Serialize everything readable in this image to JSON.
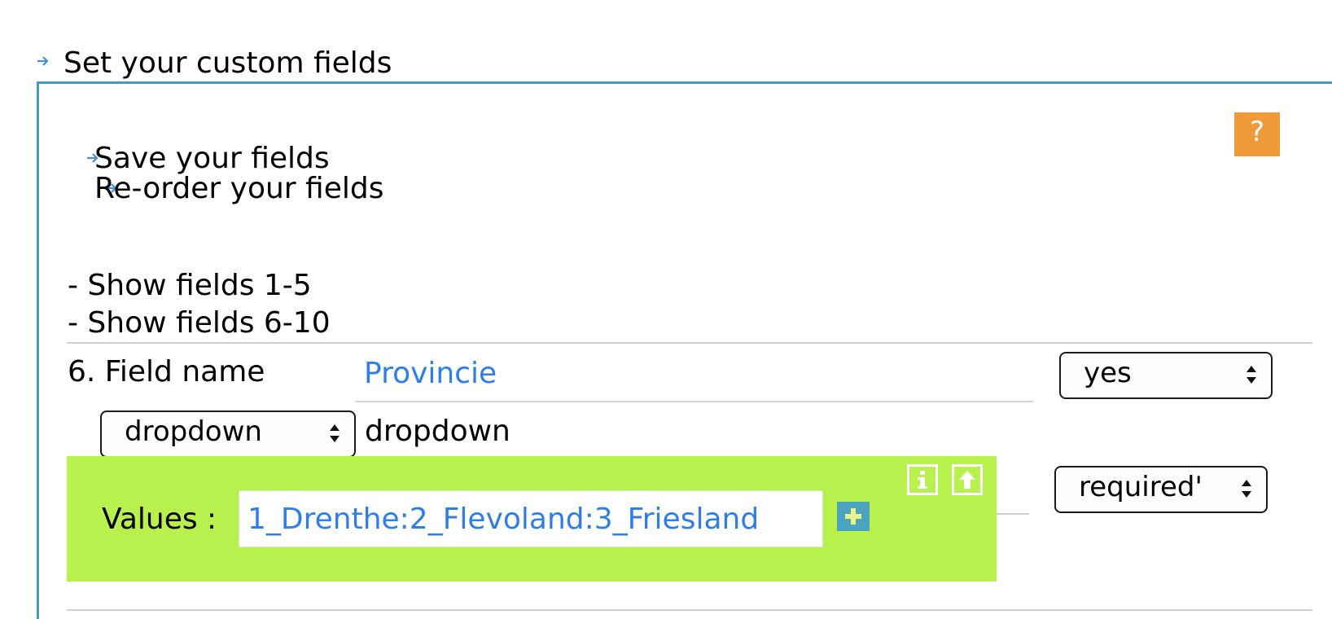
{
  "section_title": "Set your custom fields",
  "help_button": "?",
  "links": {
    "save": "Save your fields",
    "reorder": "Re-order your fields",
    "show_1_5": "- Show fields 1-5",
    "show_6_10": "- Show fields 6-10"
  },
  "field": {
    "name_label": "6. Field name",
    "name_value": "Provincie",
    "visible_select": "yes",
    "type_select": "dropdown",
    "type_text": "dropdown",
    "required_select": "required'",
    "values_label": "Values :",
    "values_value": "1_Drenthe:2_Flevoland:3_Friesland"
  },
  "icons": {
    "bullet": "arrow-right-icon",
    "info": "info-icon",
    "upload": "up-arrow-icon",
    "add": "plus-icon"
  },
  "colors": {
    "panel_border": "#4a9cb0",
    "help_bg": "#ef9a3b",
    "values_bg": "#b8f04e",
    "link_blue": "#2f7ee6",
    "plus_bg": "#4aa4c0"
  }
}
